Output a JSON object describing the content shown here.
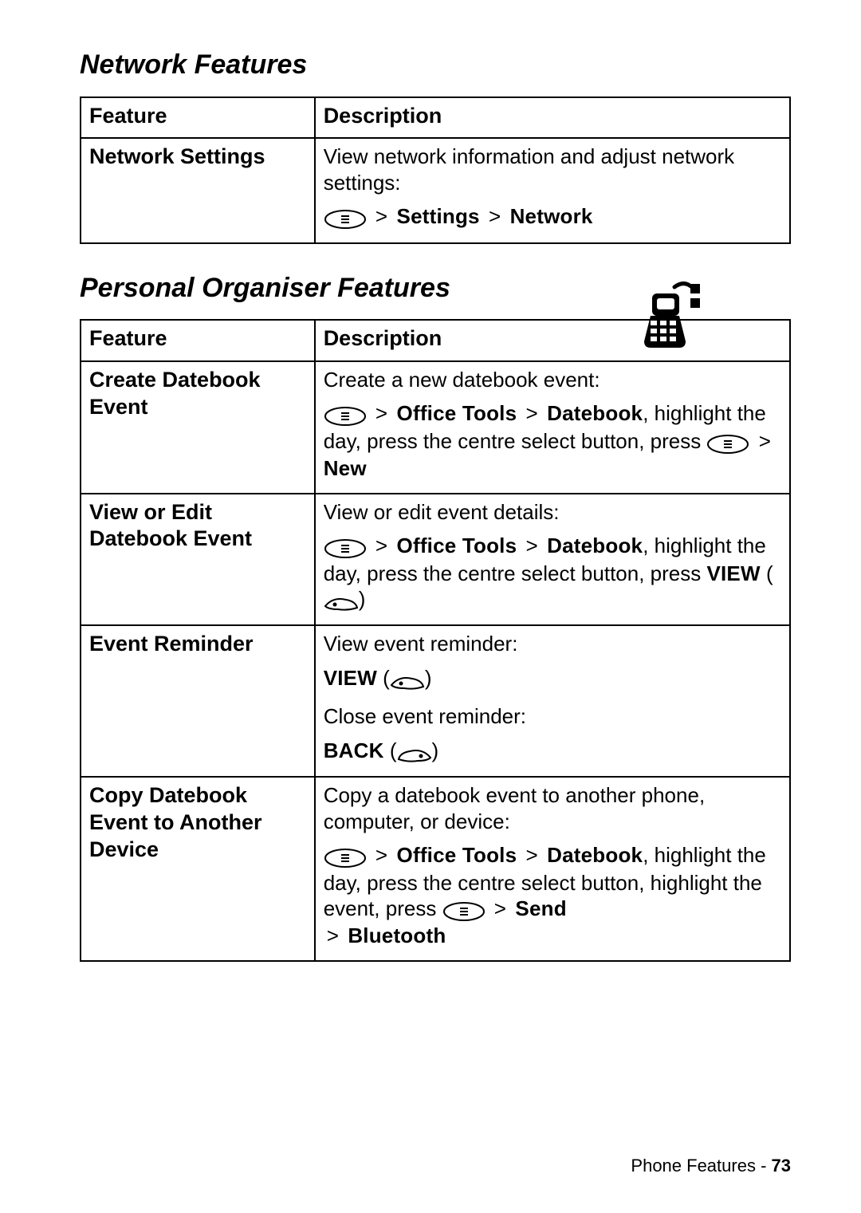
{
  "section1": {
    "title": "Network Features",
    "headers": {
      "feature": "Feature",
      "description": "Description"
    },
    "rows": [
      {
        "feature": "Network Settings",
        "desc": "View network information and adjust network settings:",
        "path_parts": {
          "p1": "Settings",
          "p2": "Network"
        }
      }
    ]
  },
  "section2": {
    "title": "Personal Organiser Features",
    "headers": {
      "feature": "Feature",
      "description": "Description"
    },
    "rows": [
      {
        "feature": "Create Datebook Event",
        "desc": "Create a new datebook event:",
        "path": {
          "p1": "Office Tools",
          "p2": "Datebook",
          "tail": ", highlight the day, press the centre select button, press ",
          "p3": "New"
        }
      },
      {
        "feature": "View or Edit Datebook Event",
        "desc": "View or edit event details:",
        "path": {
          "p1": "Office Tools",
          "p2": "Datebook",
          "tail": ", highlight the day, press the centre select button, press ",
          "key_label": "VIEW"
        }
      },
      {
        "feature": "Event Reminder",
        "desc1": "View event reminder:",
        "key1": "VIEW",
        "desc2": "Close event reminder:",
        "key2": "BACK"
      },
      {
        "feature": "Copy Datebook Event to Another Device",
        "desc": "Copy a datebook event to another phone, computer, or device:",
        "path": {
          "p1": "Office Tools",
          "p2": "Datebook",
          "tail1": ", highlight the day, press the centre select button, highlight the event, press ",
          "p3": "Send",
          "p4": "Bluetooth"
        }
      }
    ]
  },
  "footer": {
    "label": "Phone Features - ",
    "page": "73"
  },
  "glyphs": {
    "gt": ">",
    "paren_open": "(",
    "paren_close": ")"
  }
}
